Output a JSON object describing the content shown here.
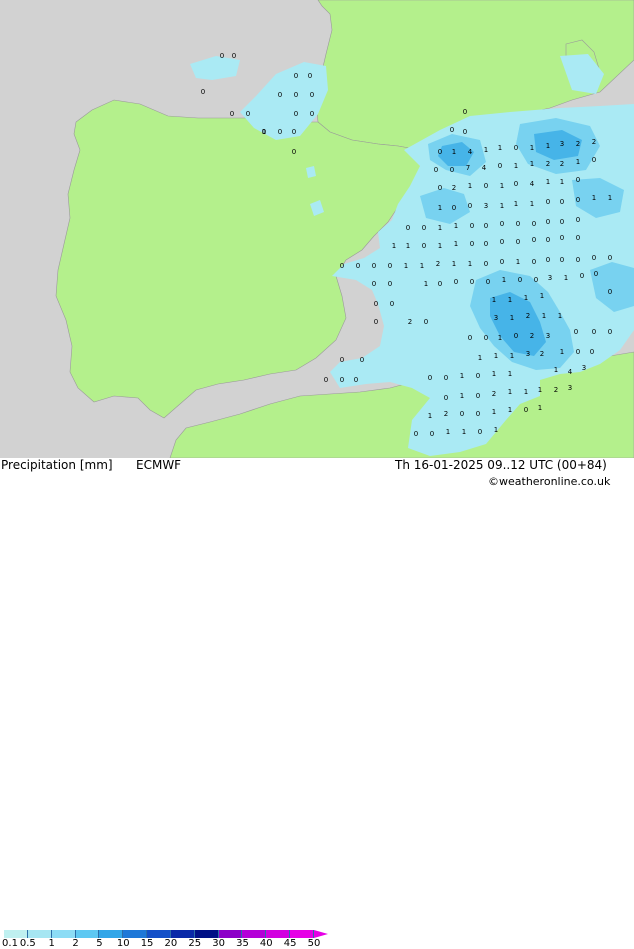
{
  "footer": {
    "title": "Precipitation [mm]",
    "model": "ECMWF",
    "datetime": "Th 16-01-2025 09..12 UTC (00+84)",
    "credit": "©weatheronline.co.uk"
  },
  "legend": {
    "ticks": [
      "0.1",
      "0.5",
      "1",
      "2",
      "5",
      "10",
      "15",
      "20",
      "25",
      "30",
      "35",
      "40",
      "45",
      "50"
    ],
    "colors": [
      "#bff0f0",
      "#a6e6f2",
      "#8cdcf5",
      "#5ec8f2",
      "#32a6e8",
      "#1e78d8",
      "#1450c8",
      "#0a2aa8",
      "#001086",
      "#8c00c8",
      "#b400d8",
      "#d200e0",
      "#e600e6"
    ]
  },
  "colors": {
    "sea": "#d2d2d2",
    "land": "#b4f08c",
    "precip_light": "#aaeaf4",
    "precip_mid": "#78d2f0",
    "precip_high": "#46b4e8"
  },
  "values": [
    {
      "t": "0"
    },
    {
      "t": "0"
    },
    {
      "t": "0"
    },
    {
      "t": "0"
    },
    {
      "t": "0"
    },
    {
      "t": "0"
    },
    {
      "t": "0"
    },
    {
      "t": "0"
    },
    {
      "t": "0"
    },
    {
      "t": "0"
    },
    {
      "t": "0"
    },
    {
      "t": "0"
    },
    {
      "t": "0"
    },
    {
      "t": "0"
    },
    {
      "t": "1"
    },
    {
      "t": "0"
    },
    {
      "t": "0"
    },
    {
      "t": "0"
    },
    {
      "t": "0"
    },
    {
      "t": "0"
    },
    {
      "t": "1"
    },
    {
      "t": "0"
    },
    {
      "t": "4"
    },
    {
      "t": "1"
    },
    {
      "t": "1"
    },
    {
      "t": "0"
    },
    {
      "t": "1"
    },
    {
      "t": "1"
    },
    {
      "t": "3"
    },
    {
      "t": "2"
    },
    {
      "t": "2"
    },
    {
      "t": "0"
    },
    {
      "t": "0"
    },
    {
      "t": "7"
    },
    {
      "t": "4"
    },
    {
      "t": "0"
    },
    {
      "t": "1"
    },
    {
      "t": "1"
    },
    {
      "t": "2"
    },
    {
      "t": "2"
    },
    {
      "t": "1"
    },
    {
      "t": "0"
    },
    {
      "t": "0"
    },
    {
      "t": "2"
    },
    {
      "t": "1"
    },
    {
      "t": "0"
    },
    {
      "t": "1"
    },
    {
      "t": "0"
    },
    {
      "t": "4"
    },
    {
      "t": "1"
    },
    {
      "t": "1"
    },
    {
      "t": "0"
    },
    {
      "t": "1"
    },
    {
      "t": "0"
    },
    {
      "t": "0"
    },
    {
      "t": "3"
    },
    {
      "t": "1"
    },
    {
      "t": "1"
    },
    {
      "t": "1"
    },
    {
      "t": "0"
    },
    {
      "t": "0"
    },
    {
      "t": "0"
    },
    {
      "t": "1"
    },
    {
      "t": "1"
    },
    {
      "t": "0"
    },
    {
      "t": "0"
    },
    {
      "t": "1"
    },
    {
      "t": "1"
    },
    {
      "t": "0"
    },
    {
      "t": "0"
    },
    {
      "t": "0"
    },
    {
      "t": "0"
    },
    {
      "t": "0"
    },
    {
      "t": "0"
    },
    {
      "t": "0"
    },
    {
      "t": "0"
    },
    {
      "t": "1"
    },
    {
      "t": "1"
    },
    {
      "t": "0"
    },
    {
      "t": "1"
    },
    {
      "t": "1"
    },
    {
      "t": "0"
    },
    {
      "t": "0"
    },
    {
      "t": "0"
    },
    {
      "t": "0"
    },
    {
      "t": "0"
    },
    {
      "t": "0"
    },
    {
      "t": "0"
    },
    {
      "t": "0"
    },
    {
      "t": "0"
    },
    {
      "t": "0"
    },
    {
      "t": "0"
    },
    {
      "t": "0"
    },
    {
      "t": "1"
    },
    {
      "t": "1"
    },
    {
      "t": "2"
    },
    {
      "t": "1"
    },
    {
      "t": "1"
    },
    {
      "t": "0"
    },
    {
      "t": "0"
    },
    {
      "t": "1"
    },
    {
      "t": "0"
    },
    {
      "t": "0"
    },
    {
      "t": "0"
    },
    {
      "t": "0"
    },
    {
      "t": "0"
    },
    {
      "t": "0"
    },
    {
      "t": "0"
    },
    {
      "t": "0"
    },
    {
      "t": "1"
    },
    {
      "t": "0"
    },
    {
      "t": "0"
    },
    {
      "t": "0"
    },
    {
      "t": "0"
    },
    {
      "t": "1"
    },
    {
      "t": "0"
    },
    {
      "t": "0"
    },
    {
      "t": "3"
    },
    {
      "t": "1"
    },
    {
      "t": "0"
    },
    {
      "t": "0"
    },
    {
      "t": "0"
    },
    {
      "t": "1"
    },
    {
      "t": "1"
    },
    {
      "t": "1"
    },
    {
      "t": "1"
    },
    {
      "t": "0"
    },
    {
      "t": "0"
    },
    {
      "t": "2"
    },
    {
      "t": "0"
    },
    {
      "t": "3"
    },
    {
      "t": "1"
    },
    {
      "t": "2"
    },
    {
      "t": "1"
    },
    {
      "t": "1"
    },
    {
      "t": "0"
    },
    {
      "t": "0"
    },
    {
      "t": "0"
    },
    {
      "t": "0"
    },
    {
      "t": "0"
    },
    {
      "t": "0"
    },
    {
      "t": "1"
    },
    {
      "t": "0"
    },
    {
      "t": "2"
    },
    {
      "t": "3"
    },
    {
      "t": "1"
    },
    {
      "t": "0"
    },
    {
      "t": "0"
    },
    {
      "t": "0"
    },
    {
      "t": "0"
    },
    {
      "t": "1"
    },
    {
      "t": "1"
    },
    {
      "t": "1"
    },
    {
      "t": "3"
    },
    {
      "t": "2"
    },
    {
      "t": "1"
    },
    {
      "t": "4"
    },
    {
      "t": "3"
    },
    {
      "t": "0"
    },
    {
      "t": "0"
    },
    {
      "t": "0"
    },
    {
      "t": "0"
    },
    {
      "t": "0"
    },
    {
      "t": "1"
    },
    {
      "t": "0"
    },
    {
      "t": "1"
    },
    {
      "t": "1"
    },
    {
      "t": "1"
    },
    {
      "t": "1"
    },
    {
      "t": "2"
    },
    {
      "t": "3"
    },
    {
      "t": "0"
    },
    {
      "t": "1"
    },
    {
      "t": "0"
    },
    {
      "t": "2"
    },
    {
      "t": "1"
    },
    {
      "t": "1"
    },
    {
      "t": "2"
    },
    {
      "t": "0"
    },
    {
      "t": "0"
    },
    {
      "t": "1"
    },
    {
      "t": "1"
    },
    {
      "t": "0"
    },
    {
      "t": "1"
    },
    {
      "t": "0"
    },
    {
      "t": "0"
    },
    {
      "t": "1"
    },
    {
      "t": "1"
    },
    {
      "t": "0"
    },
    {
      "t": "1"
    },
    {
      "t": "0"
    },
    {
      "t": "0"
    },
    {
      "t": "0"
    },
    {
      "t": "0"
    },
    {
      "t": "0"
    },
    {
      "t": "0"
    },
    {
      "t": "0"
    }
  ]
}
